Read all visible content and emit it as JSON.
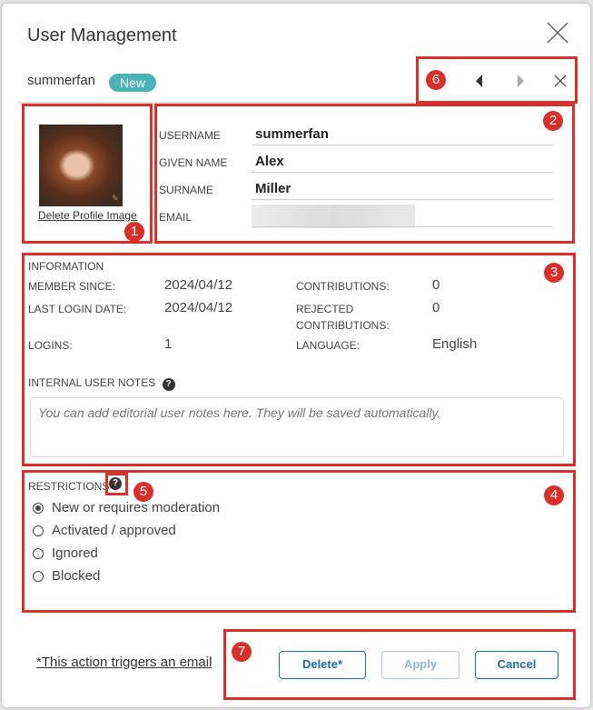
{
  "dialog": {
    "title": "User Management",
    "username_heading": "summerfan",
    "status_badge": "New",
    "badge_color": "#4ab3b8"
  },
  "annotations": [
    "1",
    "2",
    "3",
    "4",
    "5",
    "6",
    "7"
  ],
  "nav": {
    "prev_icon": "caret-left-icon",
    "next_icon": "caret-right-icon",
    "close_icon": "close-icon"
  },
  "profile": {
    "image_alt": "profile-image",
    "delete_label": "Delete Profile Image",
    "edit_icon": "pencil-icon"
  },
  "fields": [
    {
      "label": "USERNAME",
      "value": "summerfan"
    },
    {
      "label": "GIVEN NAME",
      "value": "Alex"
    },
    {
      "label": "SURNAME",
      "value": "Miller"
    },
    {
      "label": "EMAIL",
      "value": ""
    }
  ],
  "information": {
    "heading": "INFORMATION",
    "member_since_label": "MEMBER SINCE:",
    "member_since": "2024/04/12",
    "last_login_label": "LAST LOGIN DATE:",
    "last_login": "2024/04/12",
    "logins_label": "LOGINS:",
    "logins": "1",
    "contributions_label": "CONTRIBUTIONS:",
    "contributions": "0",
    "rejected_label_1": "REJECTED",
    "rejected_label_2": "CONTRIBUTIONS:",
    "rejected": "0",
    "language_label": "LANGUAGE:",
    "language": "English"
  },
  "notes": {
    "label": "INTERNAL USER NOTES",
    "placeholder": "You can add editorial user notes here. They will be saved automatically.",
    "value": ""
  },
  "restrictions": {
    "label": "RESTRICTIONS",
    "options": [
      {
        "label": "New or requires moderation",
        "selected": true
      },
      {
        "label": "Activated / approved",
        "selected": false
      },
      {
        "label": "Ignored",
        "selected": false
      },
      {
        "label": "Blocked",
        "selected": false
      }
    ]
  },
  "footer": {
    "email_note": "*This action triggers an email",
    "delete_label": "Delete*",
    "apply_label": "Apply",
    "cancel_label": "Cancel",
    "apply_disabled": true,
    "button_color": "#1b6ea6"
  },
  "help_glyph": "?"
}
